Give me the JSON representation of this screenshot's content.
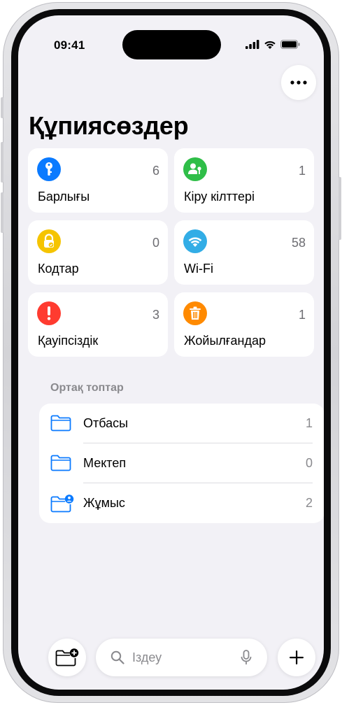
{
  "status_bar": {
    "time": "09:41"
  },
  "header": {
    "title": "Құпиясөздер"
  },
  "tiles": [
    {
      "label": "Барлығы",
      "count": "6",
      "icon": "key-icon",
      "color": "#0a7aff"
    },
    {
      "label": "Кіру кілттері",
      "count": "1",
      "icon": "person-key-icon",
      "color": "#2fbe48"
    },
    {
      "label": "Кодтар",
      "count": "0",
      "icon": "lock-icon",
      "color": "#f5c400"
    },
    {
      "label": "Wi-Fi",
      "count": "58",
      "icon": "wifi-icon",
      "color": "#32ade6"
    },
    {
      "label": "Қауіпсіздік",
      "count": "3",
      "icon": "exclamation-icon",
      "color": "#ff3b30"
    },
    {
      "label": "Жойылғандар",
      "count": "1",
      "icon": "trash-icon",
      "color": "#ff8a00"
    }
  ],
  "shared_groups": {
    "title": "Ортақ топтар",
    "items": [
      {
        "name": "Отбасы",
        "count": "1",
        "icon": "folder-icon"
      },
      {
        "name": "Мектеп",
        "count": "0",
        "icon": "folder-icon"
      },
      {
        "name": "Жұмыс",
        "count": "2",
        "icon": "folder-person-icon"
      }
    ]
  },
  "bottom_bar": {
    "search_placeholder": "Іздеу",
    "new_group_icon": "folder-plus-icon",
    "add_icon": "plus-icon",
    "mic_icon": "mic-icon"
  },
  "colors": {
    "accent": "#0a7aff",
    "background": "#f2f1f6"
  }
}
